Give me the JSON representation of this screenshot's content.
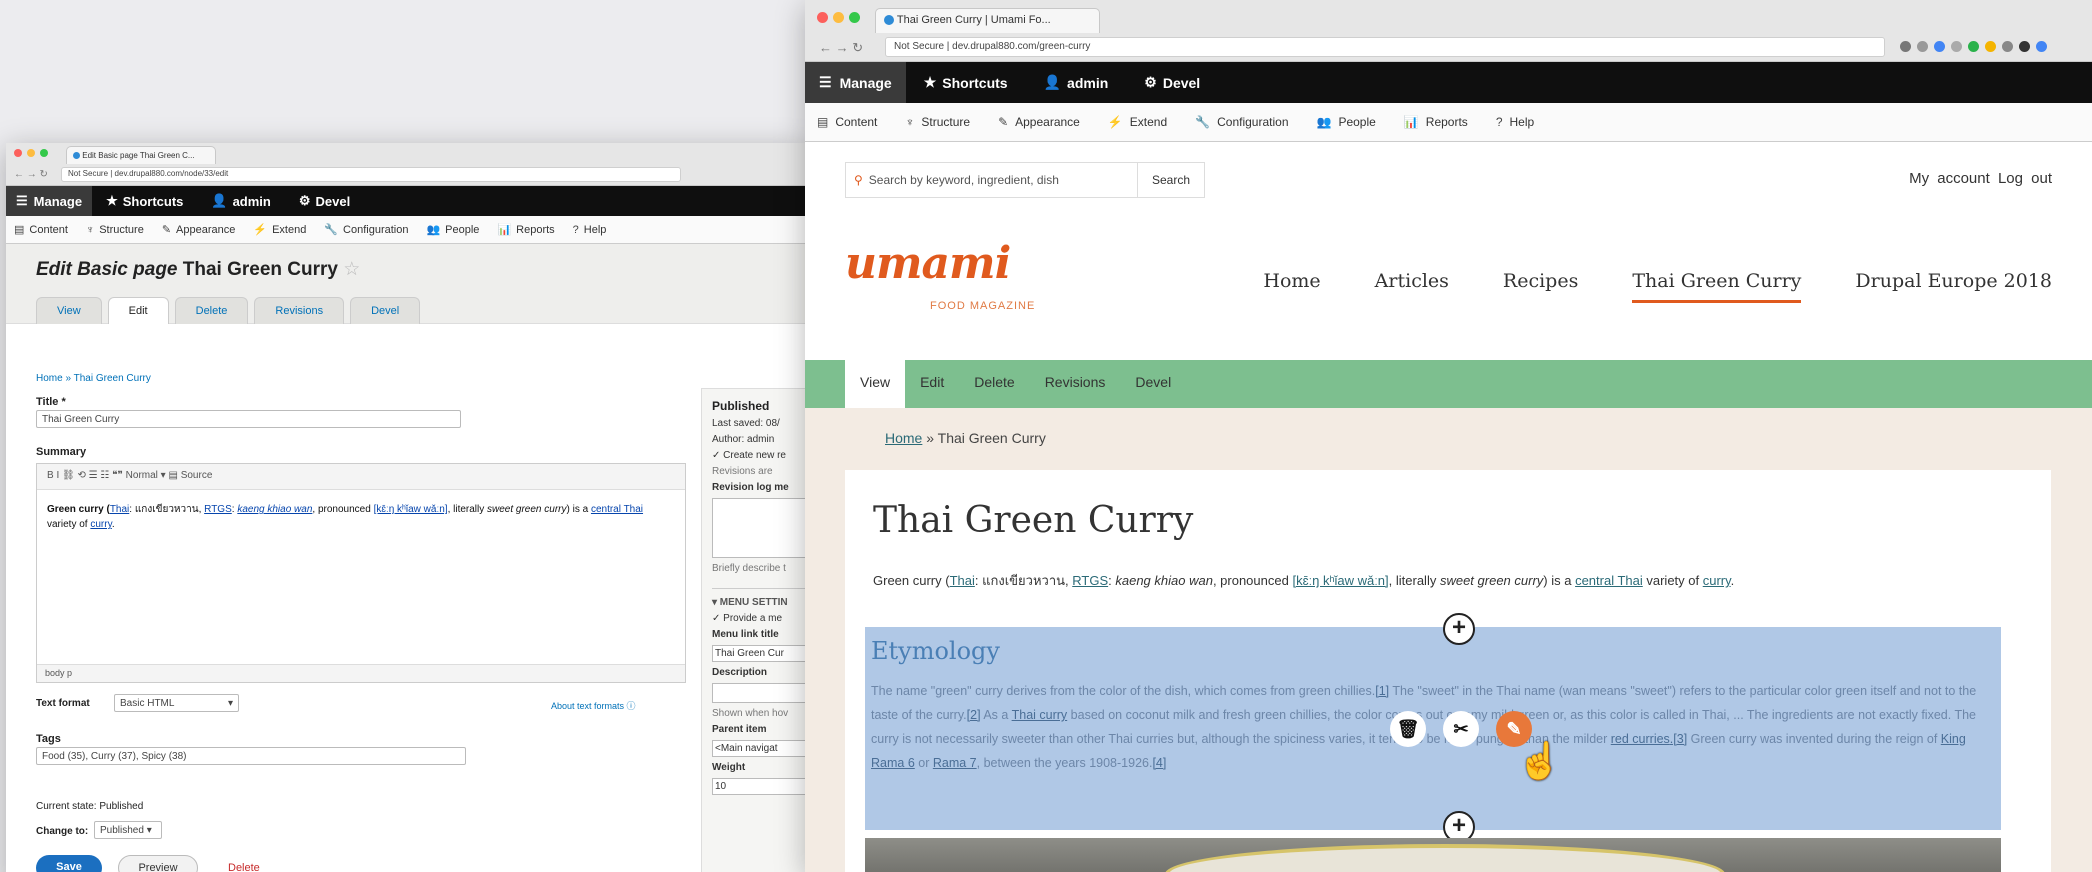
{
  "admin_window": {
    "browser_tab": "Edit Basic page Thai Green C...",
    "address": "Not Secure | dev.drupal880.com/node/33/edit",
    "toolbar": {
      "manage": "Manage",
      "shortcuts": "Shortcuts",
      "user": "admin",
      "devel": "Devel"
    },
    "admin_menu": [
      "Content",
      "Structure",
      "Appearance",
      "Extend",
      "Configuration",
      "People",
      "Reports",
      "Help"
    ],
    "title_prefix": "Edit Basic page",
    "title_main": "Thai Green Curry",
    "tabs": [
      "View",
      "Edit",
      "Delete",
      "Revisions",
      "Devel"
    ],
    "breadcrumb": "Home » Thai Green Curry",
    "form": {
      "title_label": "Title *",
      "title_value": "Thai Green Curry",
      "summary_label": "Summary",
      "editor_toolbar": "B  I  ⛓  ⟲  ☰  ☷  ❝❞  Normal  ▾  ▤ Source",
      "body_text_start": "Green curry (",
      "body_link_thai": "Thai",
      "body_thai": ": แกงเขียวหวาน, ",
      "body_link_rtgs": "RTGS",
      "body_after_rtgs": ": ",
      "body_kaeng": "kaeng khiao wan",
      "body_pron": ", pronounced ",
      "body_link_ipa": "[kɛ̄ːŋ kʰǐaw wǎːn]",
      "body_lit": ", literally ",
      "body_sweet": "sweet green curry",
      "body_isa": ") is a ",
      "body_link_central": "central Thai",
      "body_variety": " variety of ",
      "body_link_curry": "curry",
      "body_end": ".",
      "editor_footer": "body  p",
      "text_format_label": "Text format",
      "text_format_value": "Basic HTML",
      "about_formats": "About text formats ⓘ",
      "tags_label": "Tags",
      "tags_value": "Food (35), Curry (37), Spicy (38)",
      "current_state": "Current state: Published",
      "change_to_label": "Change to:",
      "change_to_value": "Published ▾",
      "save": "Save",
      "preview": "Preview",
      "delete": "Delete"
    },
    "sidebar": {
      "published": "Published",
      "last_saved": "Last saved: 08/",
      "author": "Author: admin",
      "create_new": "✓ Create new re",
      "revisions": "Revisions are",
      "revision_log": "Revision log me",
      "briefly": "Briefly describe t",
      "menu_settings": "▾ MENU SETTIN",
      "provide": "✓ Provide a me",
      "menu_link_title": "Menu link title",
      "menu_link_value": "Thai Green Cur",
      "description": "Description",
      "shown_when": "Shown when hov",
      "parent_item": "Parent item",
      "parent_value": "<Main navigat",
      "weight": "Weight",
      "weight_value": "10"
    }
  },
  "front_window": {
    "browser_tab": "Thai Green Curry | Umami Fo...",
    "address": "Not Secure | dev.drupal880.com/green-curry",
    "toolbar": {
      "manage": "Manage",
      "shortcuts": "Shortcuts",
      "user": "admin",
      "devel": "Devel"
    },
    "admin_menu": [
      "Content",
      "Structure",
      "Appearance",
      "Extend",
      "Configuration",
      "People",
      "Reports",
      "Help"
    ],
    "search_placeholder": "Search by keyword, ingredient, dish",
    "search_button": "Search",
    "my_account": "My account",
    "log_out": "Log out",
    "logo": "umami",
    "logo_sub": "FOOD MAGAZINE",
    "main_menu": [
      "Home",
      "Articles",
      "Recipes",
      "Thai Green Curry",
      "Drupal Europe 2018"
    ],
    "local_tabs": [
      "View",
      "Edit",
      "Delete",
      "Revisions",
      "Devel"
    ],
    "breadcrumb_home": "Home",
    "breadcrumb_rest": " » Thai Green Curry",
    "heading": "Thai Green Curry",
    "intro": {
      "a": "Green curry (",
      "thai": "Thai",
      "b": ": แกงเขียวหวาน, ",
      "rtgs": "RTGS",
      "c": ": ",
      "kaeng": "kaeng khiao wan",
      "d": ", pronounced ",
      "ipa": "[kɛ̄ːŋ kʰǐaw wǎːn]",
      "e": ", literally ",
      "sweet": "sweet green curry",
      "f": ") is a ",
      "central": "central Thai",
      "g": " variety of ",
      "curry": "curry",
      "h": "."
    },
    "etymology_heading": "Etymology",
    "etymology": {
      "p1": "The name \"green\" curry derives from the color of the dish, which comes from green chillies.",
      "ref1": "[1]",
      "p2": " The \"sweet\" in the Thai name (wan means \"sweet\") refers to the particular color green itself and not to the taste of the curry.",
      "ref2": "[2]",
      "p3": " As a ",
      "thai_curry": "Thai curry",
      "p4": " based on coconut milk and fresh green chillies, the color comes out creamy mild green or, as this color is called in Thai, ... The ingredients are not exactly fixed. The curry is not necessarily sweeter than other Thai curries but, although the spiciness varies, it tends to be more pungent than the milder ",
      "red_curries": "red curries",
      "ref3": ".[3]",
      "p5": " Green curry was invented during the reign of ",
      "rama6": "King Rama 6",
      "p6": " or ",
      "rama7": "Rama 7",
      "p7": ", between the years 1908-1926.",
      "ref4": "[4]"
    },
    "block_actions": {
      "add": "+",
      "delete": "🗑",
      "cut": "✂",
      "edit": "✎"
    }
  }
}
